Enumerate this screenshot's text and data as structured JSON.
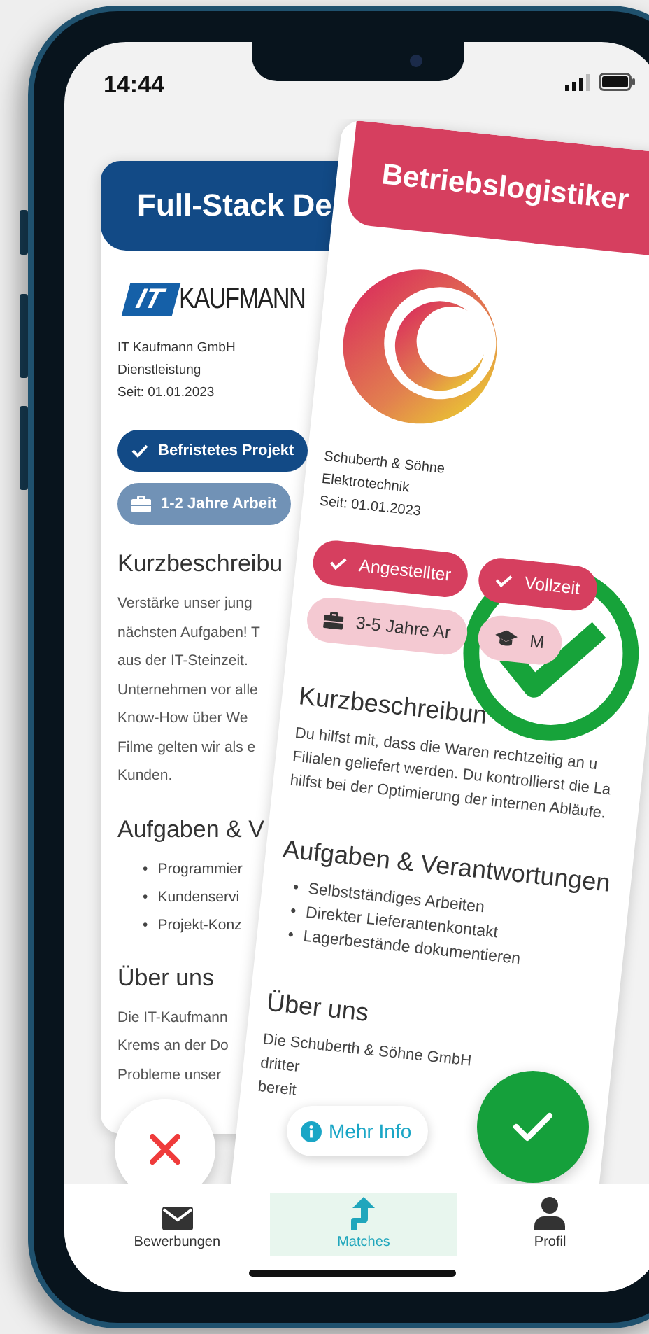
{
  "status_bar": {
    "time": "14:44"
  },
  "cards": [
    {
      "kind": "wordmark",
      "title": "Full-Stack De",
      "color": "#124a86",
      "logo_text": [
        "IT",
        "KAUFMANN"
      ],
      "company": [
        "IT Kaufmann GmbH",
        "Dienstleistung",
        "Seit: 01.01.2023"
      ],
      "chips": [
        {
          "kind": "check",
          "label": "Befristetes Projekt"
        },
        {
          "kind": "experience",
          "label": "1-2 Jahre Arbeit"
        }
      ],
      "sections": [
        {
          "heading": "Kurzbeschreibu",
          "lines": [
            "Verstärke unser jung",
            "nächsten Aufgaben! T",
            "aus der IT-Steinzeit.",
            "Unternehmen vor alle",
            "Know-How über We",
            "Filme gelten wir als e",
            "Kunden."
          ]
        },
        {
          "heading": "Aufgaben & V",
          "bullet": "•",
          "bullets": [
            "Programmier",
            "Kundenservi",
            "Projekt-Konz"
          ]
        },
        {
          "heading": "Über uns",
          "lines": [
            "Die IT-Kaufmann",
            "Krems an der Do",
            "Probleme unser"
          ]
        }
      ]
    },
    {
      "kind": "emblem",
      "title": "Betriebslogistiker",
      "color": "#d63f5f",
      "company": [
        "Schuberth & Söhne",
        "Elektrotechnik",
        "Seit: 01.01.2023"
      ],
      "overlay": {
        "kind": "accept"
      },
      "chips": [
        {
          "kind": "check",
          "label": "Angestellter"
        },
        {
          "kind": "check",
          "label": "Vollzeit"
        },
        {
          "kind": "experience",
          "label": "3-5 Jahre Ar"
        },
        {
          "kind": "education",
          "label": "M"
        }
      ],
      "sections": [
        {
          "heading": "Kurzbeschreibun",
          "lines": [
            "Du hilfst mit, dass die Waren rechtzeitig an u",
            "Filialen geliefert werden. Du kontrollierst die La",
            "hilfst bei der Optimierung der internen Abläufe."
          ]
        },
        {
          "heading": "Aufgaben & Verantwortungen",
          "bullet": "•",
          "bullets": [
            "Selbstständiges Arbeiten",
            "Direkter Lieferantenkontakt",
            "Lagerbestände dokumentieren"
          ]
        },
        {
          "heading": "Über uns",
          "lines": [
            "Die Schuberth & Söhne GmbH",
            "dritter",
            "bereit"
          ]
        }
      ]
    }
  ],
  "actions": [
    {
      "kind": "reject"
    },
    {
      "kind": "info",
      "label": "Mehr Info"
    },
    {
      "kind": "accept"
    }
  ],
  "nav": [
    {
      "kind": "mail",
      "label": "Bewerbungen",
      "selected": false
    },
    {
      "kind": "match",
      "label": "Matches",
      "selected": true
    },
    {
      "kind": "profile",
      "label": "Profil",
      "selected": false
    }
  ]
}
